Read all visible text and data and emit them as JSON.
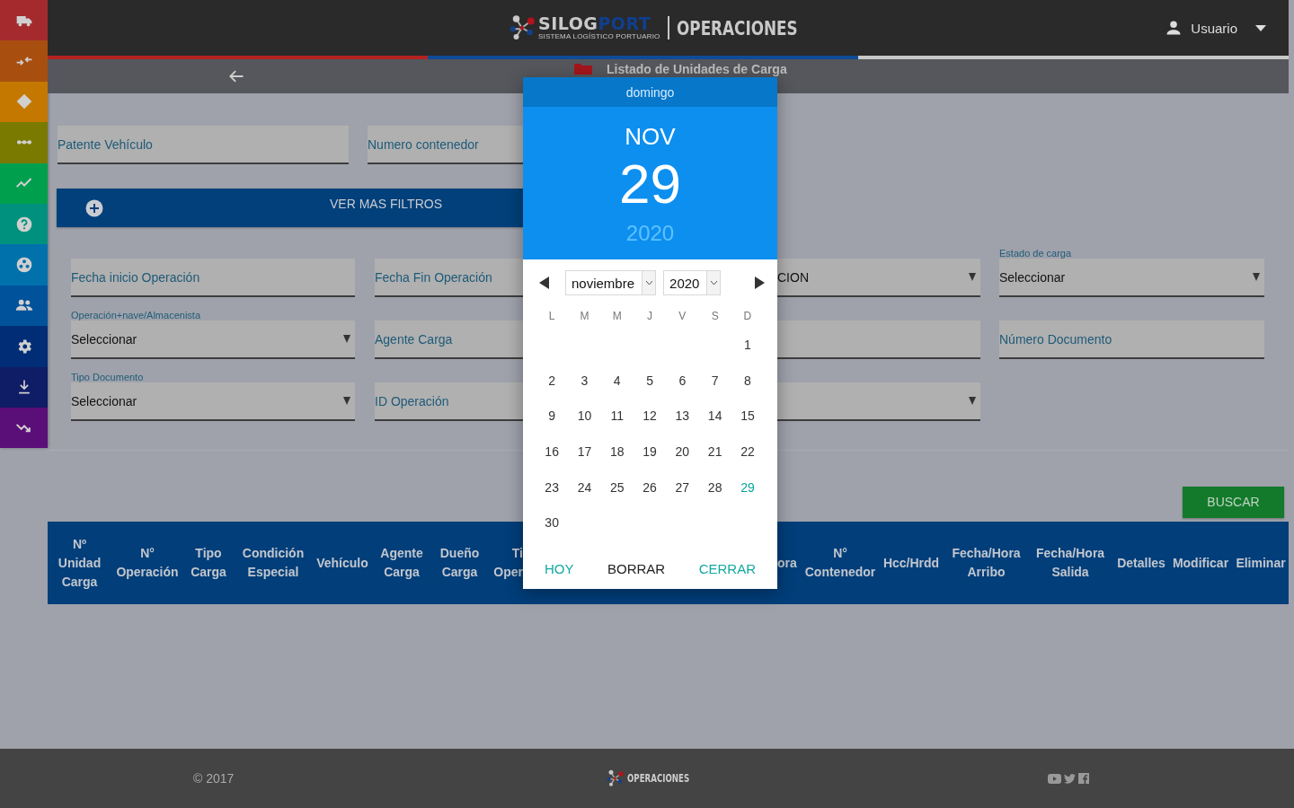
{
  "sidebar": {
    "items": [
      {
        "color": "#a52a2e"
      },
      {
        "color": "#a84f10"
      },
      {
        "color": "#c47800"
      },
      {
        "color": "#7a7a00"
      },
      {
        "color": "#009f4e"
      },
      {
        "color": "#00917e"
      },
      {
        "color": "#0071ab"
      },
      {
        "color": "#00529a"
      },
      {
        "color": "#002d75"
      },
      {
        "color": "#0f1c66"
      },
      {
        "color": "#5a0e78"
      }
    ]
  },
  "header": {
    "logo_parts": [
      "SILOG",
      "PORT"
    ],
    "tagline": "SISTEMA LOGÍSTICO PORTUARIO",
    "app_name": "OPERACIONES",
    "user": "Usuario"
  },
  "subheader": {
    "title": "Listado de Unidades de Carga"
  },
  "quick_filters": [
    {
      "kind": "input",
      "placeholder": "Patente Vehículo"
    },
    {
      "kind": "input",
      "placeholder": "Numero contenedor"
    }
  ],
  "more_filters_button": {
    "label": "VER MAS FILTROS"
  },
  "filters": [
    [
      {
        "kind": "input",
        "placeholder": "Fecha inicio Operación"
      },
      {
        "kind": "input",
        "placeholder": "Fecha Fin Operación"
      },
      {
        "kind": "select",
        "value": "CION"
      },
      {
        "kind": "select",
        "label": "Estado de carga",
        "value": "Seleccionar"
      }
    ],
    [
      {
        "kind": "select",
        "label": "Operación+nave/Almacenista",
        "value": "Seleccionar"
      },
      {
        "kind": "input",
        "placeholder": "Agente Carga"
      },
      {
        "kind": "input"
      },
      {
        "kind": "input",
        "placeholder": "Número Documento"
      }
    ],
    [
      {
        "kind": "select",
        "label": "Tipo Documento",
        "value": "Seleccionar"
      },
      {
        "kind": "input",
        "placeholder": "ID Operación"
      },
      {
        "kind": "select"
      }
    ]
  ],
  "search_button": {
    "label": "BUSCAR"
  },
  "table": {
    "columns_left": [
      "Nº\nUnidad\nCarga",
      "N°\nOperación",
      "Tipo\nCarga",
      "Condición\nEspecial",
      "Vehículo",
      "Agente\nCarga",
      "Dueño\nCarga",
      "Ti\nOper"
    ],
    "columns_right": [
      "ora",
      "N°\nContenedor",
      "Hcc/Hrdd",
      "Fecha/Hora\nArribo",
      "Fecha/Hora\nSalida",
      "Detalles",
      "Modificar",
      "Eliminar"
    ]
  },
  "datepicker": {
    "weekday_name": "domingo",
    "month_short": "NOV",
    "day": "29",
    "year": "2020",
    "month_select": "noviembre",
    "year_select": "2020",
    "weekdays": [
      "L",
      "M",
      "M",
      "J",
      "V",
      "S",
      "D"
    ],
    "weeks": [
      {
        "days": [
          {
            "day": "1",
            "selected": false
          }
        ]
      },
      {
        "days": [
          {
            "day": "2",
            "selected": false
          },
          {
            "day": "3",
            "selected": false
          },
          {
            "day": "4",
            "selected": false
          },
          {
            "day": "5",
            "selected": false
          },
          {
            "day": "6",
            "selected": false
          },
          {
            "day": "7",
            "selected": false
          },
          {
            "day": "8",
            "selected": false
          }
        ]
      },
      {
        "days": [
          {
            "day": "9",
            "selected": false
          },
          {
            "day": "10",
            "selected": false
          },
          {
            "day": "11",
            "selected": false
          },
          {
            "day": "12",
            "selected": false
          },
          {
            "day": "13",
            "selected": false
          },
          {
            "day": "14",
            "selected": false
          },
          {
            "day": "15",
            "selected": false
          }
        ]
      },
      {
        "days": [
          {
            "day": "16",
            "selected": false
          },
          {
            "day": "17",
            "selected": false
          },
          {
            "day": "18",
            "selected": false
          },
          {
            "day": "19",
            "selected": false
          },
          {
            "day": "20",
            "selected": false
          },
          {
            "day": "21",
            "selected": false
          },
          {
            "day": "22",
            "selected": false
          }
        ]
      },
      {
        "days": [
          {
            "day": "23",
            "selected": false
          },
          {
            "day": "24",
            "selected": false
          },
          {
            "day": "25",
            "selected": false
          },
          {
            "day": "26",
            "selected": false
          },
          {
            "day": "27",
            "selected": false
          },
          {
            "day": "28",
            "selected": false
          },
          {
            "day": "29",
            "selected": true
          }
        ]
      },
      {
        "days": [
          {
            "day": "30",
            "selected": false
          }
        ]
      }
    ],
    "buttons": [
      {
        "label": "HOY",
        "kind": "accent"
      },
      {
        "label": "BORRAR",
        "kind": "plain"
      },
      {
        "label": "CERRAR",
        "kind": "accent"
      }
    ]
  },
  "footer": {
    "copyright": "© 2017",
    "app_name": "OPERACIONES"
  }
}
